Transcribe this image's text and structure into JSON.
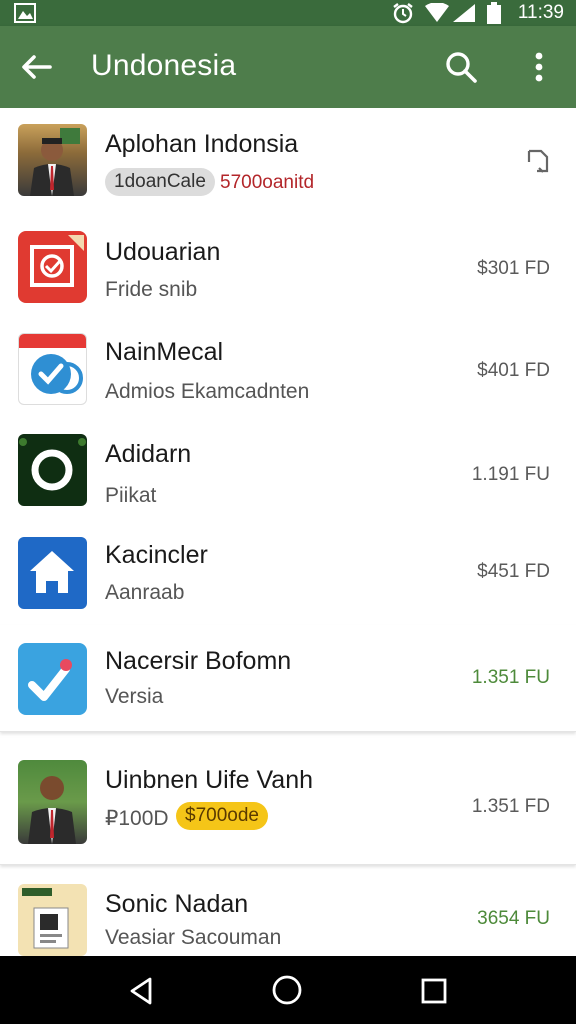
{
  "status_bar": {
    "time": "11:39"
  },
  "app_bar": {
    "title": "Undonesia"
  },
  "items": [
    {
      "title": "Aplohan Indonsia",
      "chip": "1doanCale",
      "tag": "5700oanitd",
      "price": ""
    },
    {
      "title": "Udouarian",
      "sub": "Fride snib",
      "price": "$301 FD"
    },
    {
      "title": "NainMecal",
      "sub": "Admios Ekamcadnten",
      "price": "$401 FD"
    },
    {
      "title": "Adidarn",
      "sub": "Piikat",
      "price": "1.191 FU"
    },
    {
      "title": "Kacincler",
      "sub": "Aanraab",
      "price": "$451 FD"
    },
    {
      "title": "Nacersir Bofomn",
      "sub": "Versia",
      "price": "1.351 FU"
    },
    {
      "title": "Uinbnen Uife Vanh",
      "sub": "₽100D",
      "chip": "$700ode",
      "price": "1.351 FD"
    },
    {
      "title": "Sonic Nadan",
      "sub": "Veasiar Sacouman",
      "price": "3654 FU"
    }
  ],
  "colors": {
    "app_bar": "#4e7d4b",
    "status_bar": "#3a6b3c",
    "accent_green": "#4d8a3a",
    "chip_yellow": "#f5c518"
  }
}
